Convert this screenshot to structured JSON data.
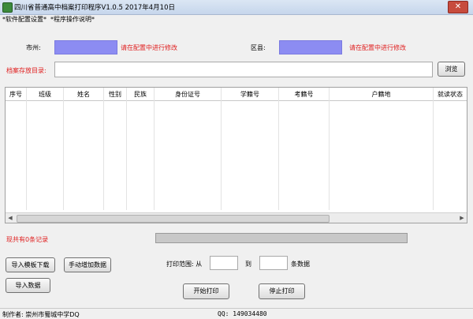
{
  "window": {
    "title": "四川省普通高中档案打印程序V1.0.5    2017年4月10日",
    "close_symbol": "✕"
  },
  "menu": {
    "items": [
      "*软件配置设置*",
      "*程序操作说明*"
    ]
  },
  "form": {
    "city_label": "市州:",
    "city_hint": "请在配置中进行修改",
    "district_label": "区县:",
    "district_hint": "请在配置中进行修改",
    "dir_label": "档案存放目录:",
    "dir_value": "",
    "browse_label": "浏览"
  },
  "table": {
    "columns": [
      "序号",
      "班级",
      "姓名",
      "性别",
      "民族",
      "身份证号",
      "学籍号",
      "考籍号",
      "户籍地",
      "就读状态"
    ],
    "rows": []
  },
  "record_count_text": "现共有0条记录",
  "buttons": {
    "import_template": "导入模板下载",
    "manual_add": "手动增加数据",
    "import_data": "导入数据",
    "start_print": "开始打印",
    "stop_print": "停止打印"
  },
  "print_range": {
    "label": "打印范围: 从",
    "to_label": "到",
    "unit_label": "条数据",
    "from_value": "",
    "to_value": ""
  },
  "progress_fraction": 0,
  "status": {
    "author": "制作者: 崇州市蜀城中学DQ",
    "qq": "QQ: 149034480"
  },
  "colors": {
    "hint_red": "#e02020",
    "placeholder_box": "#8c8cf2"
  }
}
